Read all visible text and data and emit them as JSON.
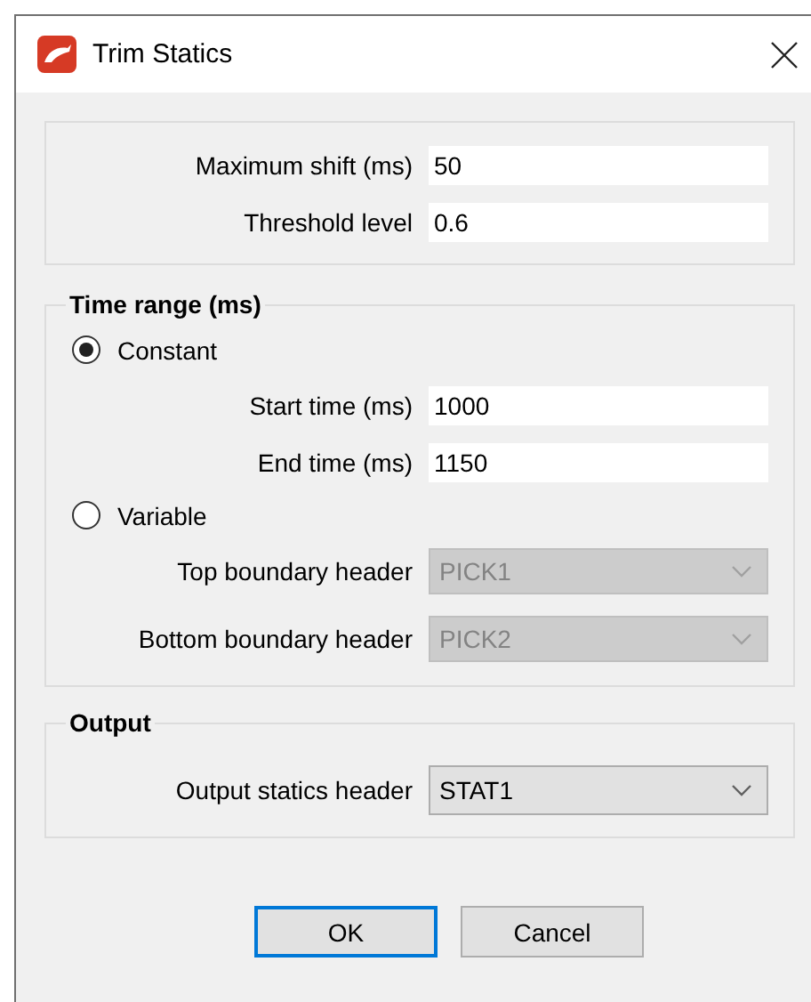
{
  "window": {
    "title": "Trim Statics"
  },
  "parameters": {
    "fields": [
      {
        "label": "Maximum shift (ms)",
        "kind": "text",
        "value": "50",
        "disabled": false
      },
      {
        "label": "Threshold level",
        "kind": "text",
        "value": "0.6",
        "disabled": false
      }
    ]
  },
  "time_range": {
    "title": "Time range (ms)",
    "options": [
      {
        "label": "Constant",
        "selected": true,
        "fields": [
          {
            "label": "Start time (ms)",
            "kind": "text",
            "value": "1000",
            "disabled": false
          },
          {
            "label": "End time (ms)",
            "kind": "text",
            "value": "1150",
            "disabled": false
          }
        ]
      },
      {
        "label": "Variable",
        "selected": false,
        "fields": [
          {
            "label": "Top boundary header",
            "kind": "combo",
            "value": "PICK1",
            "disabled": true
          },
          {
            "label": "Bottom boundary header",
            "kind": "combo",
            "value": "PICK2",
            "disabled": true
          }
        ]
      }
    ]
  },
  "output": {
    "title": "Output",
    "fields": [
      {
        "label": "Output statics header",
        "kind": "combo",
        "value": "STAT1",
        "disabled": false
      }
    ]
  },
  "buttons": [
    {
      "label": "OK",
      "default": true
    },
    {
      "label": "Cancel",
      "default": false
    }
  ]
}
